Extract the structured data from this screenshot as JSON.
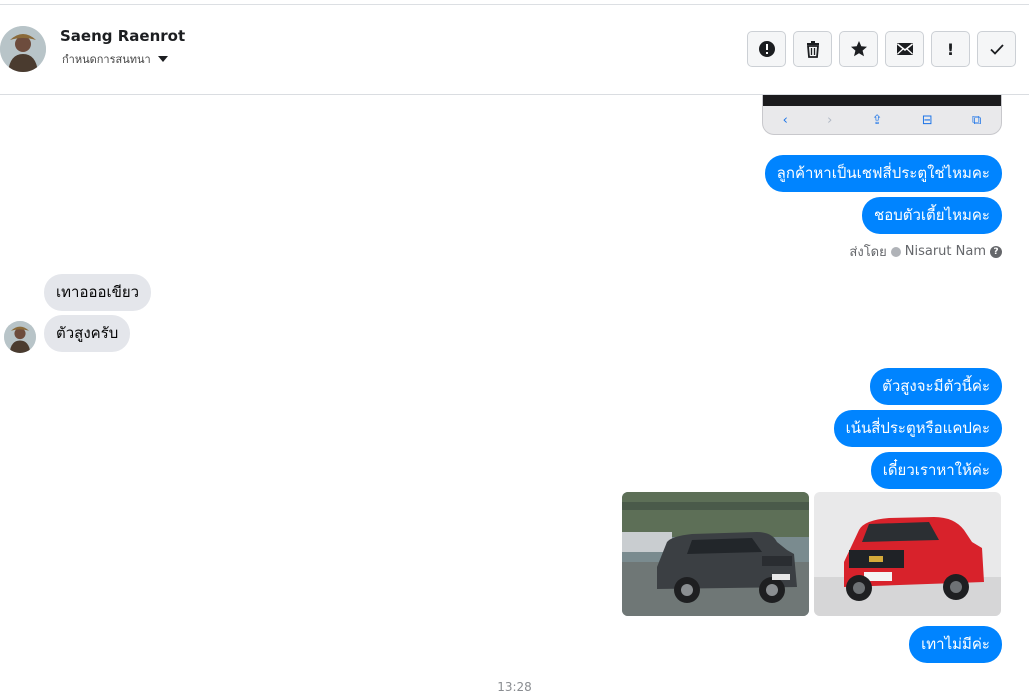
{
  "header": {
    "contact_name": "Saeng Raenrot",
    "convo_menu_label": "กำหนดการสนทนา",
    "toolbar": [
      {
        "name": "report-spam-button",
        "icon": "alert-circle-icon"
      },
      {
        "name": "delete-button",
        "icon": "trash-icon"
      },
      {
        "name": "star-button",
        "icon": "star-icon"
      },
      {
        "name": "mark-unread-button",
        "icon": "envelope-icon"
      },
      {
        "name": "follow-up-button",
        "icon": "exclamation-icon"
      },
      {
        "name": "mark-done-button",
        "icon": "checkmark-icon"
      }
    ]
  },
  "thread": {
    "phone_nav_glyphs": [
      "‹",
      "›",
      "⇪",
      "⊟",
      "⧉"
    ],
    "messages": [
      {
        "from": "page",
        "text": "ลูกค้าหาเป็นเชฟสี่ประตูใช่ไหมคะ"
      },
      {
        "from": "page",
        "text": "ชอบตัวเตี้ยไหมคะ"
      },
      {
        "from": "customer",
        "text": "เทาอออเขียว"
      },
      {
        "from": "customer",
        "text": "ตัวสูงครับ"
      },
      {
        "from": "page",
        "text": "ตัวสูงจะมีตัวนี้ค่ะ"
      },
      {
        "from": "page",
        "text": "เน้นสี่ประตูหรือแคปคะ"
      },
      {
        "from": "page",
        "text": "เดี๋ยวเราหาให้ค่ะ"
      },
      {
        "from": "page",
        "text": "เทาไม่มีค่ะ"
      }
    ],
    "sent_by_prefix": "ส่งโดย",
    "sent_by_name": "Nisarut Nam",
    "timestamp": "13:28"
  },
  "colors": {
    "outgoing_bubble": "#0084ff",
    "incoming_bubble": "#e4e6eb",
    "header_border": "#dadde1"
  }
}
